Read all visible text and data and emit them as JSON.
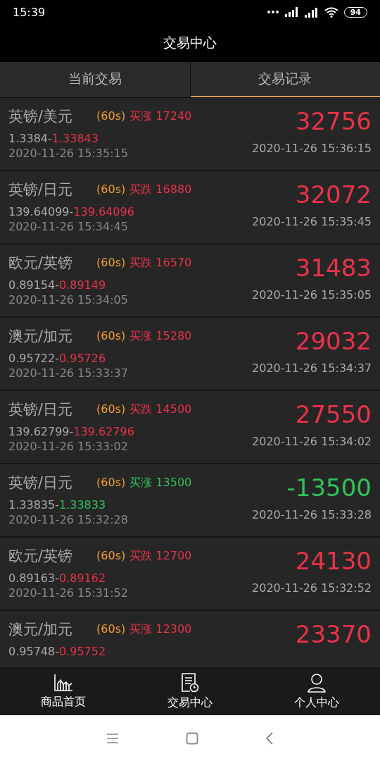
{
  "status_bar": {
    "time": "15:39",
    "battery": "94"
  },
  "header": {
    "title": "交易中心"
  },
  "tabs": [
    {
      "label": "当前交易",
      "selected": false
    },
    {
      "label": "交易记录",
      "selected": true
    }
  ],
  "trades": [
    {
      "pair": "英镑/美元",
      "duration": "(60s)",
      "direction": "买涨",
      "amount": "17240",
      "open_price": "1.3384-",
      "close_price": "1.33843",
      "open_time": "2020-11-26 15:35:15",
      "profit": "32756",
      "close_time": "2020-11-26 15:36:15",
      "color": "#e8334a"
    },
    {
      "pair": "英镑/日元",
      "duration": "(60s)",
      "direction": "买跌",
      "amount": "16880",
      "open_price": "139.64099-",
      "close_price": "139.64096",
      "open_time": "2020-11-26 15:34:45",
      "profit": "32072",
      "close_time": "2020-11-26 15:35:45",
      "color": "#e8334a"
    },
    {
      "pair": "欧元/英镑",
      "duration": "(60s)",
      "direction": "买跌",
      "amount": "16570",
      "open_price": "0.89154-",
      "close_price": "0.89149",
      "open_time": "2020-11-26 15:34:05",
      "profit": "31483",
      "close_time": "2020-11-26 15:35:05",
      "color": "#e8334a"
    },
    {
      "pair": "澳元/加元",
      "duration": "(60s)",
      "direction": "买涨",
      "amount": "15280",
      "open_price": "0.95722-",
      "close_price": "0.95726",
      "open_time": "2020-11-26 15:33:37",
      "profit": "29032",
      "close_time": "2020-11-26 15:34:37",
      "color": "#e8334a"
    },
    {
      "pair": "英镑/日元",
      "duration": "(60s)",
      "direction": "买跌",
      "amount": "14500",
      "open_price": "139.62799-",
      "close_price": "139.62796",
      "open_time": "2020-11-26 15:33:02",
      "profit": "27550",
      "close_time": "2020-11-26 15:34:02",
      "color": "#e8334a"
    },
    {
      "pair": "英镑/日元",
      "duration": "(60s)",
      "direction": "买涨",
      "amount": "13500",
      "open_price": "1.33835-",
      "close_price": "1.33833",
      "open_time": "2020-11-26 15:32:28",
      "profit": "-13500",
      "close_time": "2020-11-26 15:33:28",
      "color": "#2fc25b"
    },
    {
      "pair": "欧元/英镑",
      "duration": "(60s)",
      "direction": "买跌",
      "amount": "12700",
      "open_price": "0.89163-",
      "close_price": "0.89162",
      "open_time": "2020-11-26 15:31:52",
      "profit": "24130",
      "close_time": "2020-11-26 15:32:52",
      "color": "#e8334a"
    },
    {
      "pair": "澳元/加元",
      "duration": "(60s)",
      "direction": "买涨",
      "amount": "12300",
      "open_price": "0.95748-",
      "close_price": "0.95752",
      "profit": "23370",
      "color": "#e8334a"
    }
  ],
  "bottom_nav": [
    {
      "label": "商品首页"
    },
    {
      "label": "交易中心"
    },
    {
      "label": "个人中心"
    }
  ]
}
